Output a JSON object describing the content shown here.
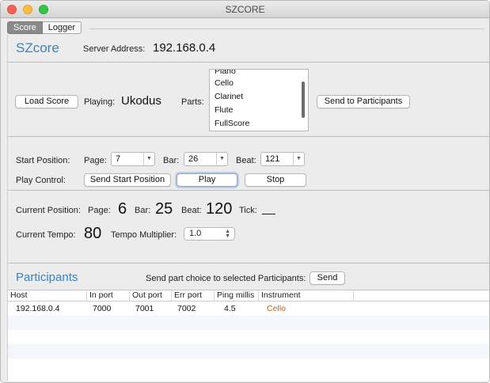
{
  "window": {
    "title": "SZCORE"
  },
  "tabs": [
    {
      "label": "Score"
    },
    {
      "label": "Logger"
    }
  ],
  "header": {
    "app_name": "SZcore",
    "server_label": "Server Address:",
    "server_value": "192.168.0.4"
  },
  "score": {
    "load_button": "Load Score",
    "playing_label": "Playing:",
    "playing_value": "Ukodus",
    "parts_label": "Parts:",
    "parts": [
      "Piano",
      "Cello",
      "Clarinet",
      "Flute",
      "FullScore"
    ],
    "send_participants_button": "Send to Participants"
  },
  "start_position": {
    "label": "Start Position:",
    "page_label": "Page:",
    "page_value": "7",
    "bar_label": "Bar:",
    "bar_value": "26",
    "beat_label": "Beat:",
    "beat_value": "121"
  },
  "play_control": {
    "label": "Play Control:",
    "send_start_button": "Send Start Position",
    "play_button": "Play",
    "stop_button": "Stop"
  },
  "current_position": {
    "label": "Current Position:",
    "page_label": "Page:",
    "page_value": "6",
    "bar_label": "Bar:",
    "bar_value": "25",
    "beat_label": "Beat:",
    "beat_value": "120",
    "tick_label": "Tick:",
    "tick_value": "__"
  },
  "tempo": {
    "label": "Current Tempo:",
    "value": "80",
    "multiplier_label": "Tempo Multiplier:",
    "multiplier_value": "1.0"
  },
  "participants": {
    "title": "Participants",
    "send_label": "Send part choice to selected Participants:",
    "send_button": "Send",
    "columns": [
      "Host",
      "In port",
      "Out port",
      "Err port",
      "Ping millis",
      "Instrument"
    ],
    "rows": [
      {
        "host": "192.168.0.4",
        "in_port": "7000",
        "out_port": "7001",
        "err_port": "7002",
        "ping": "4.5",
        "instrument": "Cello"
      }
    ]
  },
  "colors": {
    "accent": "#3b82c4",
    "instrument_text": "#c8601a"
  }
}
